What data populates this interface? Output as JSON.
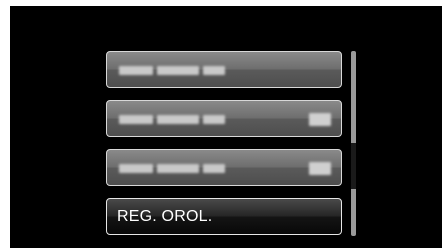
{
  "menu": {
    "items": [
      {
        "label_blurred": true,
        "has_value": false
      },
      {
        "label_blurred": true,
        "has_value": true
      },
      {
        "label_blurred": true,
        "has_value": true
      },
      {
        "label": "REG. OROL.",
        "selected": true
      }
    ]
  },
  "scrollbar": {
    "position_fraction": 0.55
  },
  "colors": {
    "screen_background": "#000000",
    "selected_item": "#141414",
    "item": "#6e6e6e"
  }
}
